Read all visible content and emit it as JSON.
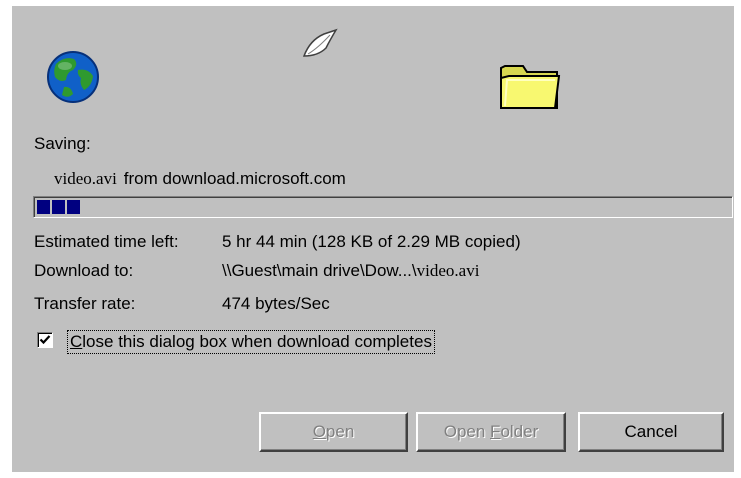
{
  "dialog": {
    "saving_label": "Saving:",
    "file_name": "video.avi",
    "from_text": "from download.microsoft.com",
    "progress_fraction": 0.06,
    "progress_blocks": 3,
    "labels": {
      "time_left": "Estimated time left:",
      "download_to": "Download to:",
      "transfer_rate": "Transfer rate:"
    },
    "values": {
      "time_left": "5 hr 44 min (128 KB of 2.29 MB copied)",
      "download_to_prefix": "\\\\Guest\\main drive\\Dow...\\",
      "download_to_file": "video.avi",
      "transfer_rate": "474 bytes/Sec"
    },
    "close_checkbox": {
      "checked": true,
      "label_accel": "C",
      "label_rest": "lose this dialog box when download completes"
    },
    "buttons": {
      "open_accel": "O",
      "open_rest": "pen",
      "open_folder_pre": "Open ",
      "open_folder_accel": "F",
      "open_folder_rest": "older",
      "cancel": "Cancel"
    },
    "icons": {
      "globe": "globe-icon",
      "paper": "flying-paper-icon",
      "folder": "folder-icon"
    }
  }
}
